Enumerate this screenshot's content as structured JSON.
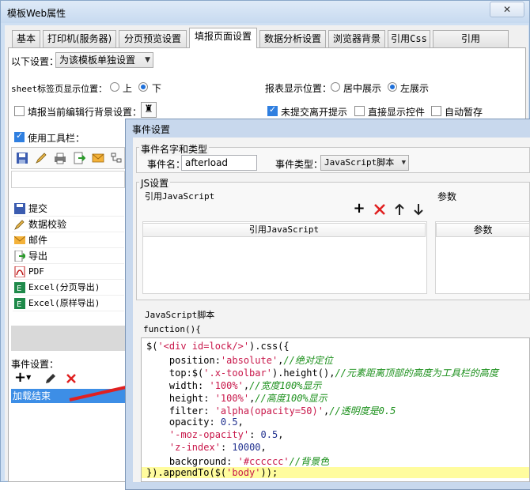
{
  "window": {
    "title": "模板Web属性",
    "close_label": "✕"
  },
  "tabs": [
    {
      "label": "基本"
    },
    {
      "label": "打印机(服务器)"
    },
    {
      "label": "分页预览设置"
    },
    {
      "label": "填报页面设置"
    },
    {
      "label": "数据分析设置"
    },
    {
      "label": "浏览器背景"
    },
    {
      "label": "引用Css"
    },
    {
      "label": "引用JavaScript"
    }
  ],
  "settings": {
    "follow_label": "以下设置：",
    "follow_value": "为该模板单独设置",
    "sheet_tab_label": "sheet标签页显示位置：",
    "sheet_tab_options": [
      "上",
      "下"
    ],
    "sheet_tab_selected": "下",
    "report_pos_label": "报表显示位置：",
    "report_pos_options": [
      "居中展示",
      "左展示"
    ],
    "report_pos_selected": "左展示",
    "fill_row_bg_label": "填报当前编辑行背景设置：",
    "unsubmitted_label": "未提交离开提示",
    "show_controls_label": "直接显示控件",
    "autosave_label": "自动暂存",
    "use_toolbar_label": "使用工具栏："
  },
  "toolbar_items": [
    {
      "label": "提交",
      "icon": "submit-icon"
    },
    {
      "label": "数据校验",
      "icon": "verify-icon"
    },
    {
      "label": "邮件",
      "icon": "mail-icon"
    },
    {
      "label": "导出",
      "icon": "export-icon"
    },
    {
      "label": "PDF",
      "icon": "pdf-icon"
    },
    {
      "label": "Excel(分页导出)",
      "icon": "excel-icon"
    },
    {
      "label": "Excel(原样导出)",
      "icon": "excel-icon"
    }
  ],
  "events": {
    "label": "事件设置：",
    "items": [
      "加载结束"
    ],
    "add_label": "+",
    "colors": {
      "selected_bg": "#3d8ee6",
      "delete": "#e02020"
    }
  },
  "dialog": {
    "title": "事件设置",
    "name_group": "事件名字和类型",
    "name_label": "事件名：",
    "name_value": "afterload",
    "type_label": "事件类型：",
    "type_value": "JavaScript脚本",
    "js_group": "JS设置",
    "ref_js_label": "引用JavaScript",
    "params_label": "参数",
    "ref_js_header": "引用JavaScript",
    "params_header": "参数",
    "script_label": "JavaScript脚本",
    "function_open": "function(){"
  },
  "code_lines": [
    {
      "parts": [
        [
          "p",
          "$("
        ],
        [
          "s",
          "'<div id=lock/>'"
        ],
        [
          "p",
          ").css({"
        ]
      ]
    },
    {
      "parts": [
        [
          "p",
          "    position:"
        ],
        [
          "s",
          "'absolute'"
        ],
        [
          "p",
          ","
        ],
        [
          "c",
          "//绝对定位"
        ]
      ]
    },
    {
      "parts": [
        [
          "p",
          "    top:$("
        ],
        [
          "s",
          "'.x-toolbar'"
        ],
        [
          "p",
          ").height(),"
        ],
        [
          "c",
          "//元素距离顶部的高度为工具栏的高度"
        ]
      ]
    },
    {
      "parts": [
        [
          "p",
          "    width: "
        ],
        [
          "s",
          "'100%'"
        ],
        [
          "p",
          ","
        ],
        [
          "c",
          "//宽度100%显示"
        ]
      ]
    },
    {
      "parts": [
        [
          "p",
          "    height: "
        ],
        [
          "s",
          "'100%'"
        ],
        [
          "p",
          ","
        ],
        [
          "c",
          "//高度100%显示"
        ]
      ]
    },
    {
      "parts": [
        [
          "p",
          "    filter: "
        ],
        [
          "s",
          "'alpha(opacity=50)'"
        ],
        [
          "p",
          ","
        ],
        [
          "c",
          "//透明度是0.5"
        ]
      ]
    },
    {
      "parts": [
        [
          "p",
          "    opacity: "
        ],
        [
          "n",
          "0.5"
        ],
        [
          "p",
          ","
        ]
      ]
    },
    {
      "parts": [
        [
          "p",
          "    "
        ],
        [
          "s",
          "'-moz-opacity'"
        ],
        [
          "p",
          ": "
        ],
        [
          "n",
          "0.5"
        ],
        [
          "p",
          ","
        ]
      ]
    },
    {
      "parts": [
        [
          "p",
          "    "
        ],
        [
          "s",
          "'z-index'"
        ],
        [
          "p",
          ": "
        ],
        [
          "n",
          "10000"
        ],
        [
          "p",
          ","
        ]
      ]
    },
    {
      "parts": [
        [
          "p",
          "    background: "
        ],
        [
          "s",
          "'#cccccc'"
        ],
        [
          "c",
          "//背景色"
        ]
      ]
    },
    {
      "parts": [
        [
          "p",
          "}).appendTo($("
        ],
        [
          "s",
          "'body'"
        ],
        [
          "p",
          "));"
        ]
      ]
    }
  ]
}
